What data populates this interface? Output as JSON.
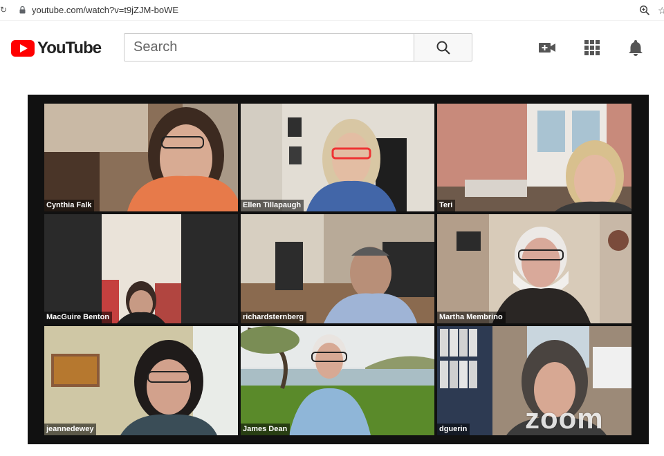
{
  "browser": {
    "url": "youtube.com/watch?v=t9jZJM-boWE",
    "icons": [
      "lock-icon",
      "zoom-icon",
      "bookmark-star-icon"
    ]
  },
  "youtube": {
    "logo_text": "YouTube",
    "search_placeholder": "Search",
    "icons": [
      "search-icon",
      "create-video-icon",
      "apps-grid-icon",
      "notifications-bell-icon"
    ],
    "brand_color": "#ff0000"
  },
  "video": {
    "watermark": "zoom",
    "active_speaker_color": "#7dd03a",
    "participants": [
      {
        "name": "Cynthia Falk"
      },
      {
        "name": "Ellen Tillapaugh"
      },
      {
        "name": "Teri"
      },
      {
        "name": "MacGuire Benton"
      },
      {
        "name": "richardsternberg"
      },
      {
        "name": "Martha Membrino"
      },
      {
        "name": "jeannedewey"
      },
      {
        "name": "James Dean"
      },
      {
        "name": "dguerin"
      }
    ]
  }
}
